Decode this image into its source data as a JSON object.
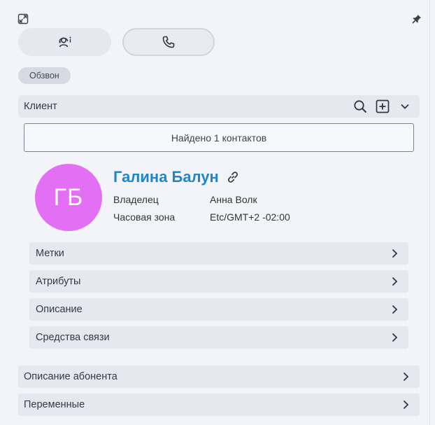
{
  "top": {
    "collapse_icon": "collapse-window-icon",
    "pin_icon": "pin-icon",
    "tabs": [
      {
        "icon": "agent-info-icon"
      },
      {
        "icon": "phone-icon"
      }
    ],
    "chip_label": "Обзвон"
  },
  "client": {
    "header": "Клиент",
    "found_text": "Найдено 1 контактов",
    "avatar_initials": "ГБ",
    "avatar_color": "#e36ff4",
    "name": "Галина Балун",
    "name_color": "#1f86c9",
    "owner_label": "Владелец",
    "owner_value": "Анна Волк",
    "timezone_label": "Часовая зона",
    "timezone_value": "Etc/GMT+2 -02:00",
    "sections": [
      {
        "label": "Метки"
      },
      {
        "label": "Атрибуты"
      },
      {
        "label": "Описание"
      },
      {
        "label": "Средства связи"
      }
    ]
  },
  "bottom_sections": [
    {
      "label": "Описание абонента"
    },
    {
      "label": "Переменные"
    }
  ]
}
